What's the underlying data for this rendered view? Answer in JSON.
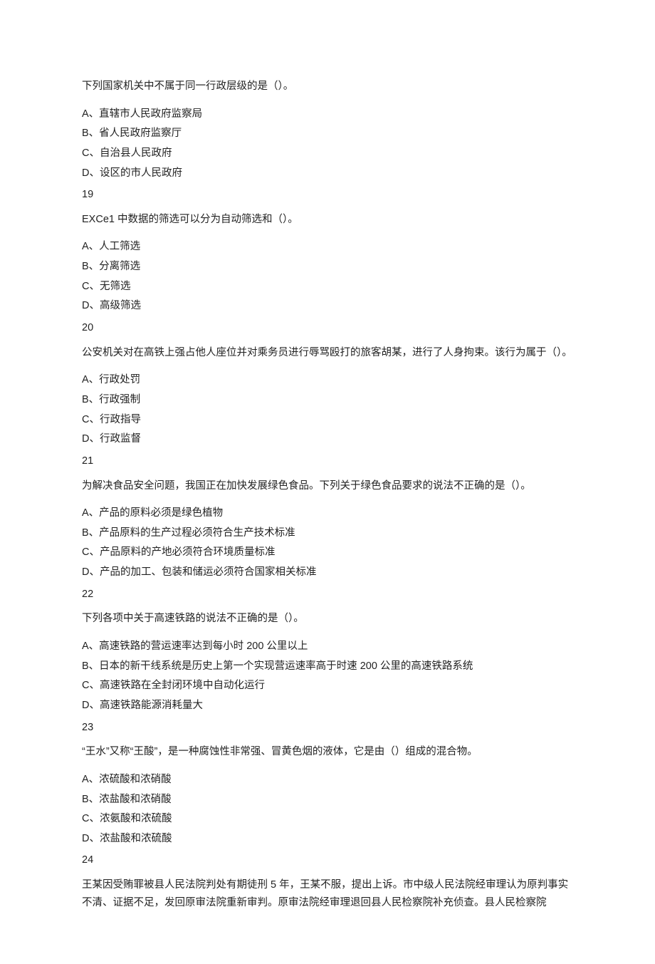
{
  "q18": {
    "stem": "下列国家机关中不属于同一行政层级的是（）。",
    "A": "A、直辖市人民政府监察局",
    "B": "B、省人民政府监察厅",
    "C": "C、自治县人民政府",
    "D": "D、设区的市人民政府"
  },
  "n19": "19",
  "q19": {
    "stem": "EXCe1 中数据的筛选可以分为自动筛选和（）。",
    "A": "A、人工筛选",
    "B": "B、分离筛选",
    "C": "C、无筛选",
    "D": "D、高级筛选"
  },
  "n20": "20",
  "q20": {
    "stem": "公安机关对在高铁上强占他人座位并对乘务员进行辱骂殴打的旅客胡某，进行了人身拘束。该行为属于（）。",
    "A": "A、行政处罚",
    "B": "B、行政强制",
    "C": "C、行政指导",
    "D": "D、行政监督"
  },
  "n21": "21",
  "q21": {
    "stem": "为解决食品安全问题，我国正在加快发展绿色食品。下列关于绿色食品要求的说法不正确的是（）。",
    "A": "A、产品的原料必须是绿色植物",
    "B": "B、产品原料的生产过程必须符合生产技术标准",
    "C": "C、产品原料的产地必须符合环境质量标准",
    "D": "D、产品的加工、包装和储运必须符合国家相关标准"
  },
  "n22": "22",
  "q22": {
    "stem": "下列各项中关于高速铁路的说法不正确的是（）。",
    "A": "A、高速铁路的营运速率达到每小时 200 公里以上",
    "B": "B、日本的新干线系统是历史上第一个实现营运速率高于时速 200 公里的高速铁路系统",
    "C": "C、高速铁路在全封闭环境中自动化运行",
    "D": "D、高速铁路能源消耗量大"
  },
  "n23": "23",
  "q23": {
    "stem": "“王水”又称“王酸”，是一种腐蚀性非常强、冒黄色烟的液体，它是由（）组成的混合物。",
    "A": "A、浓硫酸和浓硝酸",
    "B": "B、浓盐酸和浓硝酸",
    "C": "C、浓氨酸和浓硫酸",
    "D": "D、浓盐酸和浓硫酸"
  },
  "n24": "24",
  "q24": {
    "stem": "王某因受贿罪被县人民法院判处有期徒刑 5 年，王某不服，提出上诉。市中级人民法院经审理认为原判事实不清、证据不足，发回原审法院重新审判。原审法院经审理退回县人民检察院补充侦查。县人民检察院"
  }
}
